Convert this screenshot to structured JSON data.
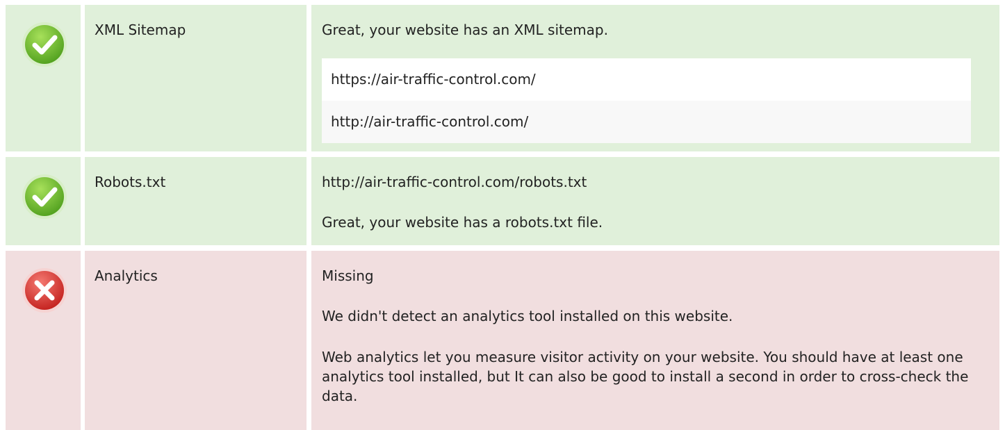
{
  "rows": [
    {
      "status": "pass",
      "icon": "checkmark-icon",
      "label": "XML Sitemap",
      "message": "Great, your website has an XML sitemap.",
      "urls": [
        "https://air-traffic-control.com/",
        "http://air-traffic-control.com/"
      ]
    },
    {
      "status": "pass",
      "icon": "checkmark-icon",
      "label": "Robots.txt",
      "url": "http://air-traffic-control.com/robots.txt",
      "message": "Great, your website has a robots.txt file."
    },
    {
      "status": "fail",
      "icon": "cross-icon",
      "label": "Analytics",
      "value": "Missing",
      "message": "We didn't detect an analytics tool installed on this website.",
      "advice": "Web analytics let you measure visitor activity on your website. You should have at least one analytics tool installed, but It can also be good to install a second in order to cross-check the data."
    }
  ],
  "colors": {
    "pass_bg": "#e0f0da",
    "fail_bg": "#f1dedf",
    "pass_icon": "#6cbf2f",
    "fail_icon": "#d9302c"
  }
}
